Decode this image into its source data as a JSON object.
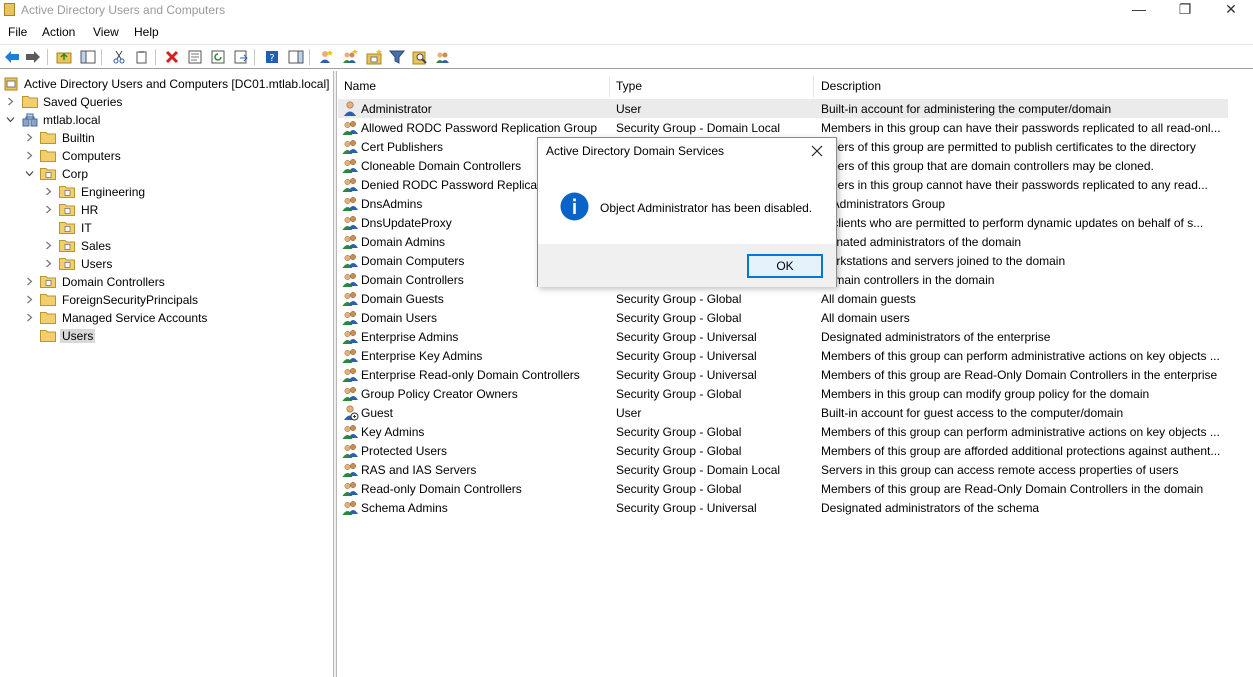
{
  "window": {
    "title": "Active Directory Users and Computers",
    "controls": {
      "minimize": "—",
      "maximize": "❐",
      "close": "✕"
    }
  },
  "menu": {
    "items": [
      "File",
      "Action",
      "View",
      "Help"
    ]
  },
  "toolbar": {
    "icons": [
      "back-icon",
      "forward-icon",
      "up-folder-icon",
      "show-hide-console-tree-icon",
      "cut-icon",
      "copy-icon",
      "delete-icon",
      "properties-icon",
      "refresh-icon",
      "export-list-icon",
      "help-icon",
      "show-action-pane-icon",
      "create-user-icon",
      "create-group-icon",
      "create-ou-icon",
      "filter-icon",
      "find-icon",
      "add-to-group-icon"
    ]
  },
  "tree": {
    "root": "Active Directory Users and Computers [DC01.mtlab.local]",
    "saved_queries": "Saved Queries",
    "domain": "mtlab.local",
    "items": [
      {
        "label": "Builtin"
      },
      {
        "label": "Computers"
      },
      {
        "label": "Corp"
      },
      {
        "label": "Engineering"
      },
      {
        "label": "HR"
      },
      {
        "label": "IT"
      },
      {
        "label": "Sales"
      },
      {
        "label": "Users"
      },
      {
        "label": "Domain Controllers"
      },
      {
        "label": "ForeignSecurityPrincipals"
      },
      {
        "label": "Managed Service Accounts"
      },
      {
        "label": "Users"
      }
    ]
  },
  "list": {
    "columns": {
      "name": "Name",
      "type": "Type",
      "description": "Description"
    },
    "rows": [
      {
        "name": "Administrator",
        "type": "User",
        "description": "Built-in account for administering the computer/domain",
        "icon": "user-icon"
      },
      {
        "name": "Allowed RODC Password Replication Group",
        "type": "Security Group - Domain Local",
        "description": "Members in this group can have their passwords replicated to all read-onl...",
        "icon": "group-icon"
      },
      {
        "name": "Cert Publishers",
        "type": "",
        "description": "mbers of this group are permitted to publish certificates to the directory",
        "icon": "group-icon"
      },
      {
        "name": "Cloneable Domain Controllers",
        "type": "",
        "description": "mbers of this group that are domain controllers may be cloned.",
        "icon": "group-icon"
      },
      {
        "name": "Denied RODC Password Replicatio",
        "type": "",
        "description": "mbers in this group cannot have their passwords replicated to any read...",
        "icon": "group-icon"
      },
      {
        "name": "DnsAdmins",
        "type": "",
        "description": "S Administrators Group",
        "icon": "group-icon"
      },
      {
        "name": "DnsUpdateProxy",
        "type": "",
        "description": "S clients who are permitted to perform dynamic updates on behalf of s...",
        "icon": "group-icon"
      },
      {
        "name": "Domain Admins",
        "type": "",
        "description": "signated administrators of the domain",
        "icon": "group-icon"
      },
      {
        "name": "Domain Computers",
        "type": "",
        "description": "workstations and servers joined to the domain",
        "icon": "group-icon"
      },
      {
        "name": "Domain Controllers",
        "type": "",
        "description": "domain controllers in the domain",
        "icon": "group-icon"
      },
      {
        "name": "Domain Guests",
        "type": "Security Group - Global",
        "description": "All domain guests",
        "icon": "group-icon"
      },
      {
        "name": "Domain Users",
        "type": "Security Group - Global",
        "description": "All domain users",
        "icon": "group-icon"
      },
      {
        "name": "Enterprise Admins",
        "type": "Security Group - Universal",
        "description": "Designated administrators of the enterprise",
        "icon": "group-icon"
      },
      {
        "name": "Enterprise Key Admins",
        "type": "Security Group - Universal",
        "description": "Members of this group can perform administrative actions on key objects ...",
        "icon": "group-icon"
      },
      {
        "name": "Enterprise Read-only Domain Controllers",
        "type": "Security Group - Universal",
        "description": "Members of this group are Read-Only Domain Controllers in the enterprise",
        "icon": "group-icon"
      },
      {
        "name": "Group Policy Creator Owners",
        "type": "Security Group - Global",
        "description": "Members in this group can modify group policy for the domain",
        "icon": "group-icon"
      },
      {
        "name": "Guest",
        "type": "User",
        "description": "Built-in account for guest access to the computer/domain",
        "icon": "disabled-user-icon"
      },
      {
        "name": "Key Admins",
        "type": "Security Group - Global",
        "description": "Members of this group can perform administrative actions on key objects ...",
        "icon": "group-icon"
      },
      {
        "name": "Protected Users",
        "type": "Security Group - Global",
        "description": "Members of this group are afforded additional protections against authent...",
        "icon": "group-icon"
      },
      {
        "name": "RAS and IAS Servers",
        "type": "Security Group - Domain Local",
        "description": "Servers in this group can access remote access properties of users",
        "icon": "group-icon"
      },
      {
        "name": "Read-only Domain Controllers",
        "type": "Security Group - Global",
        "description": "Members of this group are Read-Only Domain Controllers in the domain",
        "icon": "group-icon"
      },
      {
        "name": "Schema Admins",
        "type": "Security Group - Universal",
        "description": "Designated administrators of the schema",
        "icon": "group-icon"
      }
    ]
  },
  "dialog": {
    "title": "Active Directory Domain Services",
    "close": "✕",
    "message": "Object Administrator has been disabled.",
    "ok_label": "OK",
    "icon": "info-icon"
  },
  "colors": {
    "accent": "#0078d7",
    "selection": "#d9d9d9",
    "folder": "#e8c45a",
    "info": "#0a64c8"
  }
}
